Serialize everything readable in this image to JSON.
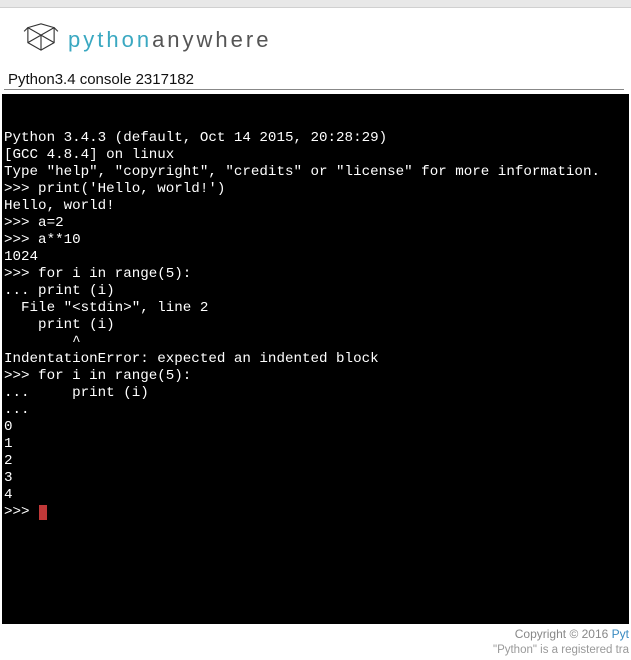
{
  "brand": {
    "python": "python",
    "anywhere": "anywhere"
  },
  "console_title": "Python3.4 console 2317182",
  "terminal": {
    "lines": [
      "Python 3.4.3 (default, Oct 14 2015, 20:28:29)",
      "[GCC 4.8.4] on linux",
      "Type \"help\", \"copyright\", \"credits\" or \"license\" for more information.",
      ">>> print('Hello, world!')",
      "Hello, world!",
      ">>> a=2",
      ">>> a**10",
      "1024",
      ">>> for i in range(5):",
      "... print (i)",
      "  File \"<stdin>\", line 2",
      "    print (i)",
      "        ^",
      "IndentationError: expected an indented block",
      ">>> for i in range(5):",
      "...     print (i)",
      "...",
      "0",
      "1",
      "2",
      "3",
      "4",
      ">>> "
    ]
  },
  "footer": {
    "copyright": "Copyright © 2016 ",
    "link": "Pyt",
    "trademark": "\"Python\" is a registered tra"
  }
}
